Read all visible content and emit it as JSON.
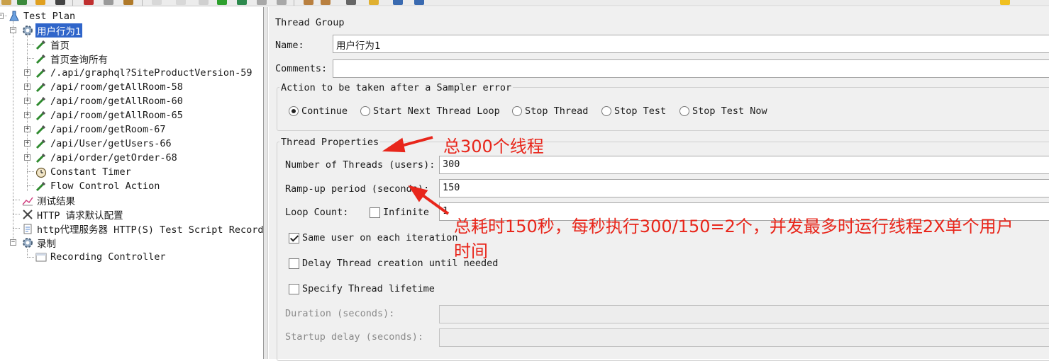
{
  "toolbar": {
    "icons": [
      "folder-icon",
      "save-icon",
      "cut-icon",
      "copy-icon",
      "paste-icon",
      "start-icon",
      "start-no-pause-icon",
      "stop-icon",
      "shutdown-icon",
      "clear-icon",
      "clear-all-icon",
      "search-icon",
      "function-helper-icon",
      "warning-icon"
    ]
  },
  "tree": {
    "items": [
      {
        "label": "Test Plan",
        "icon": "flask-icon"
      },
      {
        "label": "用户行为1",
        "icon": "gear-icon",
        "selected": true
      },
      {
        "label": "首页",
        "icon": "pipette-icon"
      },
      {
        "label": "首页查询所有",
        "icon": "pipette-icon"
      },
      {
        "label": "/.api/graphql?SiteProductVersion-59",
        "icon": "pipette-icon"
      },
      {
        "label": "/api/room/getAllRoom-58",
        "icon": "pipette-icon"
      },
      {
        "label": "/api/room/getAllRoom-60",
        "icon": "pipette-icon"
      },
      {
        "label": "/api/room/getAllRoom-65",
        "icon": "pipette-icon"
      },
      {
        "label": "/api/room/getRoom-67",
        "icon": "pipette-icon"
      },
      {
        "label": "/api/User/getUsers-66",
        "icon": "pipette-icon"
      },
      {
        "label": "/api/order/getOrder-68",
        "icon": "pipette-icon"
      },
      {
        "label": "Constant Timer",
        "icon": "timer-icon"
      },
      {
        "label": "Flow Control Action",
        "icon": "pipette-icon"
      },
      {
        "label": "测试结果",
        "icon": "chart-icon"
      },
      {
        "label": "HTTP 请求默认配置",
        "icon": "wrench-icon"
      },
      {
        "label": "http代理服务器 HTTP(S) Test Script Recorder",
        "icon": "doc-icon"
      },
      {
        "label": "录制",
        "icon": "gear-icon"
      },
      {
        "label": "Recording Controller",
        "icon": "controller-icon"
      }
    ]
  },
  "panel": {
    "title": "Thread Group",
    "name_label": "Name:",
    "name_value": "用户行为1",
    "comments_label": "Comments:",
    "comments_value": "",
    "error_action": {
      "legend": "Action to be taken after a Sampler error",
      "options": [
        "Continue",
        "Start Next Thread Loop",
        "Stop Thread",
        "Stop Test",
        "Stop Test Now"
      ],
      "selected": "Continue"
    },
    "thread_properties": {
      "legend": "Thread Properties",
      "threads_label": "Number of Threads (users):",
      "threads_value": "300",
      "rampup_label": "Ramp-up period (seconds):",
      "rampup_value": "150",
      "loop_label": "Loop Count:",
      "infinite_label": "Infinite",
      "infinite_checked": false,
      "loop_value": "1",
      "same_user_label": "Same user on each iteration",
      "same_user_checked": true,
      "delay_label": "Delay Thread creation until needed",
      "delay_checked": false,
      "lifetime_label": "Specify Thread lifetime",
      "lifetime_checked": false,
      "duration_label": "Duration (seconds):",
      "duration_value": "",
      "startup_label": "Startup delay (seconds):",
      "startup_value": ""
    }
  },
  "annotations": {
    "note1": "总300个线程",
    "note2_line1": "总耗时150秒，每秒执行300/150=2个，并发最多时运行线程2X单个用户",
    "note2_line2": "时间",
    "color": "#e8261b"
  }
}
